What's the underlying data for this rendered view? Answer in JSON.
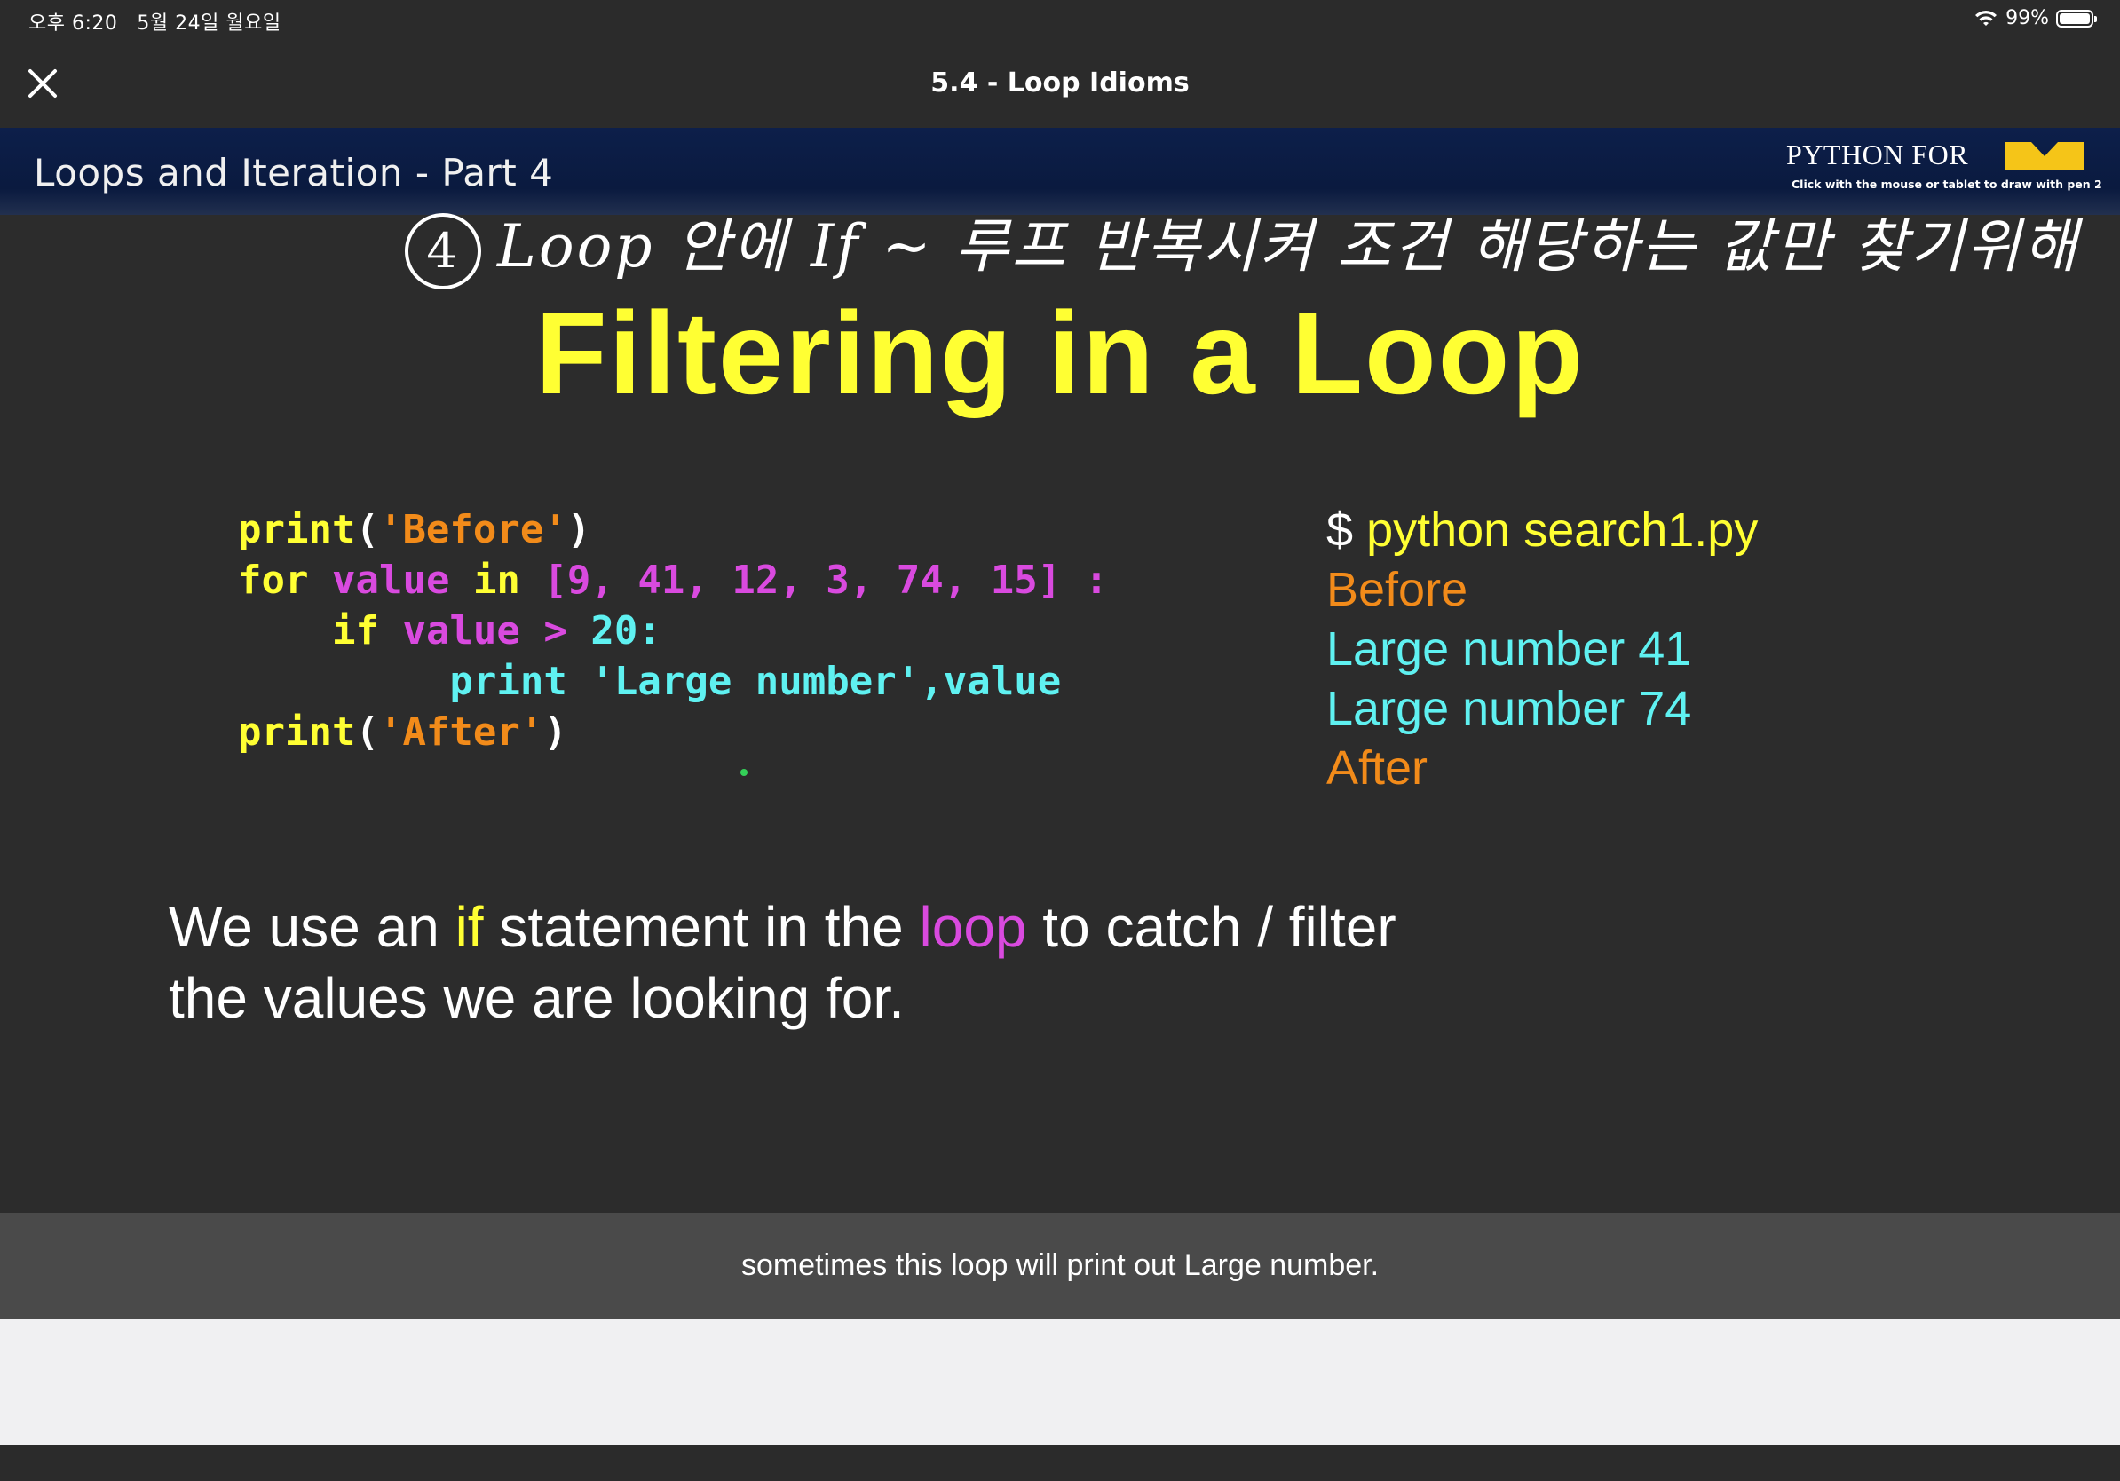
{
  "status_bar": {
    "time": "오후 6:20",
    "date": "5월 24일 월요일",
    "battery": "99%",
    "battery_level": 0.99
  },
  "header": {
    "title": "5.4 - Loop Idioms",
    "close_icon": "close-icon"
  },
  "slide": {
    "header_title": "Loops and Iteration - Part 4",
    "brand": "PYTHON FOR",
    "brand_logo": "michigan-m-logo",
    "pen_hint": "Click with the mouse or tablet to draw with pen 2",
    "handwritten_note": {
      "number": "4",
      "text": "Loop 안에 If ~ 루프 반복시켜 조건 해당하는 값만 찾기위해"
    },
    "title": "Filtering in a Loop",
    "code": {
      "line1": {
        "fn": "print",
        "open": "(",
        "str": "'Before'",
        "close": ")"
      },
      "line2": {
        "for": "for",
        "var": "value",
        "in": "in",
        "list": "[9, 41, 12, 3, 74, 15]",
        "colon": ":"
      },
      "line3": {
        "if": "if",
        "var": "value",
        "op": ">",
        "num": "20",
        "colon": ":"
      },
      "line4": {
        "fn": "print",
        "str": "'Large number'",
        "rest": ",value"
      },
      "line5": {
        "fn": "print",
        "open": "(",
        "str": "'After'",
        "close": ")"
      }
    },
    "terminal": {
      "prompt": "$",
      "command": "python search1.py",
      "output": [
        "Before",
        "Large number 41",
        "Large number 74",
        "After"
      ]
    },
    "explanation": {
      "part1": "We use an ",
      "kw_if": "if",
      "part2": " statement in the ",
      "kw_loop": "loop",
      "part3": " to catch / filter",
      "line2": "the values we are looking for."
    }
  },
  "caption": "sometimes this loop will print out Large number.",
  "colors": {
    "title_yellow": "#ffff33",
    "string_orange": "#f28b1a",
    "keyword_magenta": "#d94adf",
    "output_cyan": "#5ff1f1",
    "slide_header_navy": "#0d1f4a",
    "caption_bg": "#4a4a4a"
  }
}
